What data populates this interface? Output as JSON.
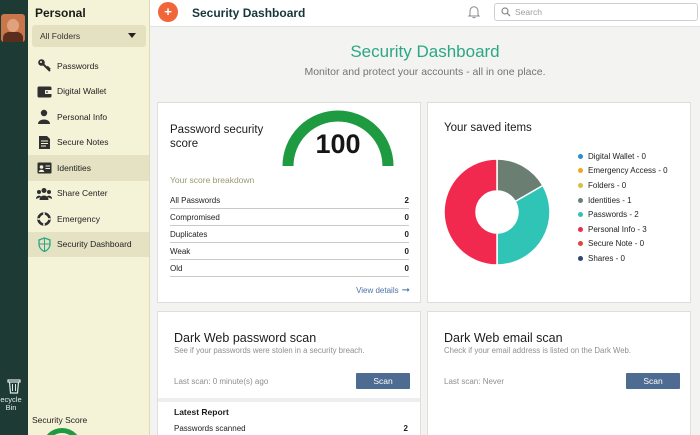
{
  "rail": {
    "avatar_icon": "user-avatar",
    "recycle_label_1": "ecycle",
    "recycle_label_2": "Bin",
    "recycle_icon": "trash-icon"
  },
  "sidebar": {
    "title": "Personal",
    "folder_select": "All Folders",
    "items": [
      {
        "label": "Passwords",
        "icon": "key-icon"
      },
      {
        "label": "Digital Wallet",
        "icon": "wallet-icon"
      },
      {
        "label": "Personal Info",
        "icon": "person-icon"
      },
      {
        "label": "Secure Notes",
        "icon": "note-icon"
      },
      {
        "label": "Identities",
        "icon": "id-card-icon"
      },
      {
        "label": "Share Center",
        "icon": "share-people-icon"
      },
      {
        "label": "Emergency",
        "icon": "lifebuoy-icon"
      },
      {
        "label": "Security Dashboard",
        "icon": "shield-icon"
      }
    ],
    "active_index": 4,
    "security_score_label": "Security Score"
  },
  "topbar": {
    "add_label": "+",
    "title": "Security Dashboard",
    "search_placeholder": "Search"
  },
  "page": {
    "title": "Security Dashboard",
    "subtitle": "Monitor and protect your accounts - all in one place."
  },
  "score_card": {
    "title": "Password security score",
    "score": "100",
    "score_fraction": 1.0,
    "breakdown_label": "Your score breakdown",
    "rows": [
      {
        "label": "All Passwords",
        "value": "2"
      },
      {
        "label": "Compromised",
        "value": "0"
      },
      {
        "label": "Duplicates",
        "value": "0"
      },
      {
        "label": "Weak",
        "value": "0"
      },
      {
        "label": "Old",
        "value": "0"
      }
    ],
    "view_details": "View details",
    "gauge_color": "#1e9a40"
  },
  "items_card": {
    "title": "Your saved items",
    "legend": [
      {
        "label": "Digital Wallet - 0",
        "color": "#2b8fcf",
        "value": 0
      },
      {
        "label": "Emergency Access - 0",
        "color": "#f0a524",
        "value": 0
      },
      {
        "label": "Folders - 0",
        "color": "#d4c23a",
        "value": 0
      },
      {
        "label": "Identities - 1",
        "color": "#6a7f72",
        "value": 1
      },
      {
        "label": "Passwords - 2",
        "color": "#30c4b6",
        "value": 2
      },
      {
        "label": "Personal Info - 3",
        "color": "#f2294e",
        "value": 3
      },
      {
        "label": "Secure Note - 0",
        "color": "#e0463c",
        "value": 0
      },
      {
        "label": "Shares - 0",
        "color": "#2c4670",
        "value": 0
      }
    ]
  },
  "dark_web_password": {
    "title": "Dark Web password scan",
    "subtitle": "See if your passwords were stolen in a security breach.",
    "last_scan": "Last scan: 0 minute(s) ago",
    "scan_button": "Scan",
    "report_title": "Latest Report",
    "report_row_label": "Passwords scanned",
    "report_row_value": "2"
  },
  "dark_web_email": {
    "title": "Dark Web email scan",
    "subtitle": "Check if your email address is listed on the Dark Web.",
    "last_scan": "Last scan: Never",
    "scan_button": "Scan"
  }
}
